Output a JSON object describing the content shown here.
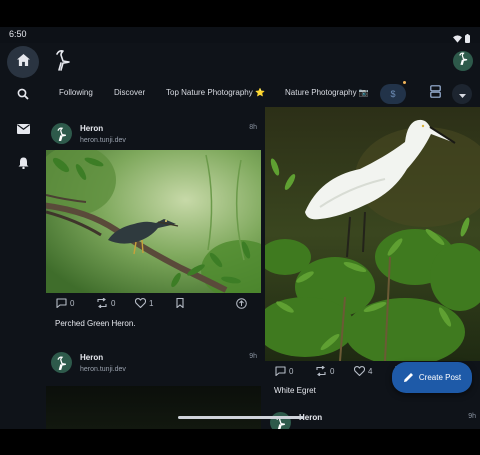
{
  "status": {
    "time": "6:50"
  },
  "rail": {
    "items": [
      {
        "name": "home",
        "icon": "home-icon",
        "active": true
      },
      {
        "name": "search",
        "icon": "search-icon",
        "active": false
      },
      {
        "name": "messages",
        "icon": "mail-icon",
        "active": false
      },
      {
        "name": "notifications",
        "icon": "bell-icon",
        "active": false
      }
    ]
  },
  "tabs": {
    "items": [
      "Following",
      "Discover",
      "Top Nature Photography ⭐",
      "Nature Photography 📷"
    ]
  },
  "posts_left": [
    {
      "name": "Heron",
      "handle": "heron.tunji.dev",
      "time": "8h",
      "replies": "0",
      "reposts": "0",
      "likes": "1",
      "caption": "Perched Green Heron."
    },
    {
      "name": "Heron",
      "handle": "heron.tunji.dev",
      "time": "9h"
    }
  ],
  "posts_right": [
    {
      "replies": "0",
      "reposts": "0",
      "likes": "4",
      "caption": "White Egret"
    },
    {
      "name": "Heron",
      "time": "9h"
    }
  ],
  "fab": {
    "label": "Create Post"
  },
  "colors": {
    "background": "#0f1319",
    "accent": "#1e5aa8",
    "avatar": "#2e5a4b"
  }
}
